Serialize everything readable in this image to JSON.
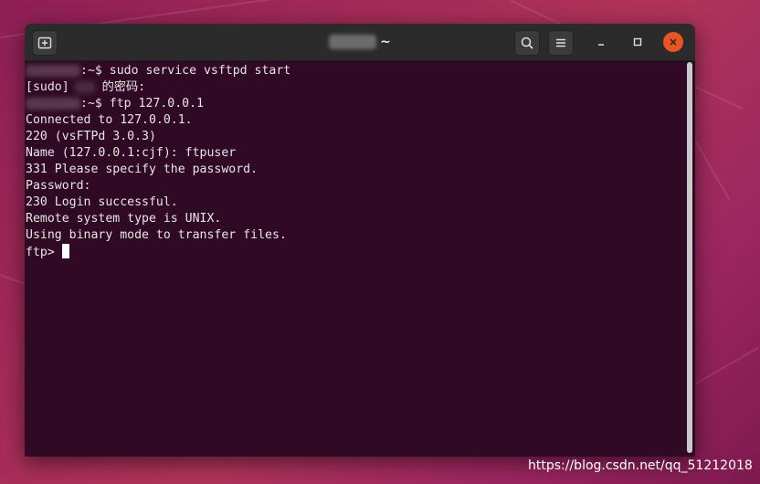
{
  "window": {
    "title_suffix": "~"
  },
  "terminal": {
    "lines": [
      {
        "kind": "prompt",
        "suffix": ":~$ sudo service vsftpd start"
      },
      {
        "kind": "sudo",
        "prefix": "[sudo]",
        "suffix": "的密码:"
      },
      {
        "kind": "prompt",
        "suffix": ":~$ ftp 127.0.0.1"
      },
      {
        "kind": "text",
        "text": "Connected to 127.0.0.1."
      },
      {
        "kind": "text",
        "text": "220 (vsFTPd 3.0.3)"
      },
      {
        "kind": "text",
        "text": "Name (127.0.0.1:cjf): ftpuser"
      },
      {
        "kind": "text",
        "text": "331 Please specify the password."
      },
      {
        "kind": "text",
        "text": "Password:"
      },
      {
        "kind": "text",
        "text": "230 Login successful."
      },
      {
        "kind": "text",
        "text": "Remote system type is UNIX."
      },
      {
        "kind": "text",
        "text": "Using binary mode to transfer files."
      }
    ],
    "ftp_prompt": "ftp> "
  },
  "icons": {
    "new_tab": "new-tab-icon",
    "search": "search-icon",
    "menu": "hamburger-menu-icon",
    "minimize": "minimize-icon",
    "maximize": "maximize-icon",
    "close": "close-icon"
  },
  "colors": {
    "terminal_bg": "#300a24",
    "titlebar_bg": "#2b2b2b",
    "close_button": "#e95420"
  },
  "watermark": "https://blog.csdn.net/qq_51212018"
}
